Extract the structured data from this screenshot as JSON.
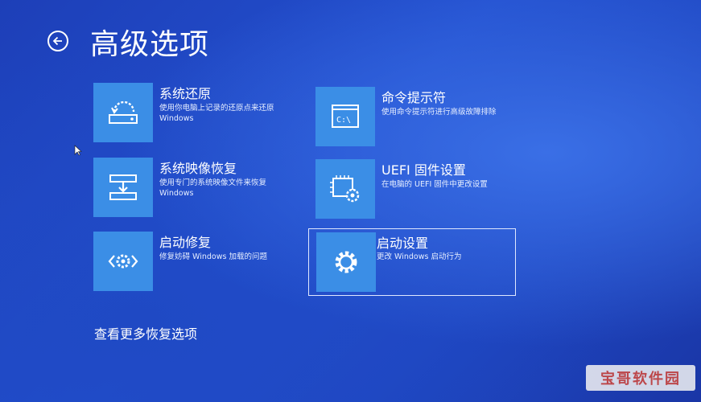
{
  "header": {
    "title": "高级选项",
    "back_icon": "back-arrow-icon"
  },
  "tiles": [
    {
      "id": "system-restore",
      "name": "系统还原",
      "desc": "使用你电脑上记录的还原点来还原 Windows",
      "icon": "restore-icon"
    },
    {
      "id": "command-prompt",
      "name": "命令提示符",
      "desc": "使用命令提示符进行高级故障排除",
      "icon": "command-prompt-icon"
    },
    {
      "id": "system-image-recovery",
      "name": "系统映像恢复",
      "desc": "使用专门的系统映像文件来恢复 Windows",
      "icon": "system-image-icon"
    },
    {
      "id": "uefi-firmware",
      "name": "UEFI 固件设置",
      "desc": "在电脑的 UEFI 固件中更改设置",
      "icon": "chip-gear-icon"
    },
    {
      "id": "startup-repair",
      "name": "启动修复",
      "desc": "修复妨碍 Windows 加载的问题",
      "icon": "code-gear-icon"
    },
    {
      "id": "startup-settings",
      "name": "启动设置",
      "desc": "更改 Windows 启动行为",
      "icon": "gear-icon"
    }
  ],
  "more_link": "查看更多恢复选项",
  "watermark": "宝哥软件园",
  "colors": {
    "background": "#2350cf",
    "tile_icon_bg": "#3b8ee6",
    "text": "#ffffff",
    "selected_border": "#e0e8ff"
  }
}
